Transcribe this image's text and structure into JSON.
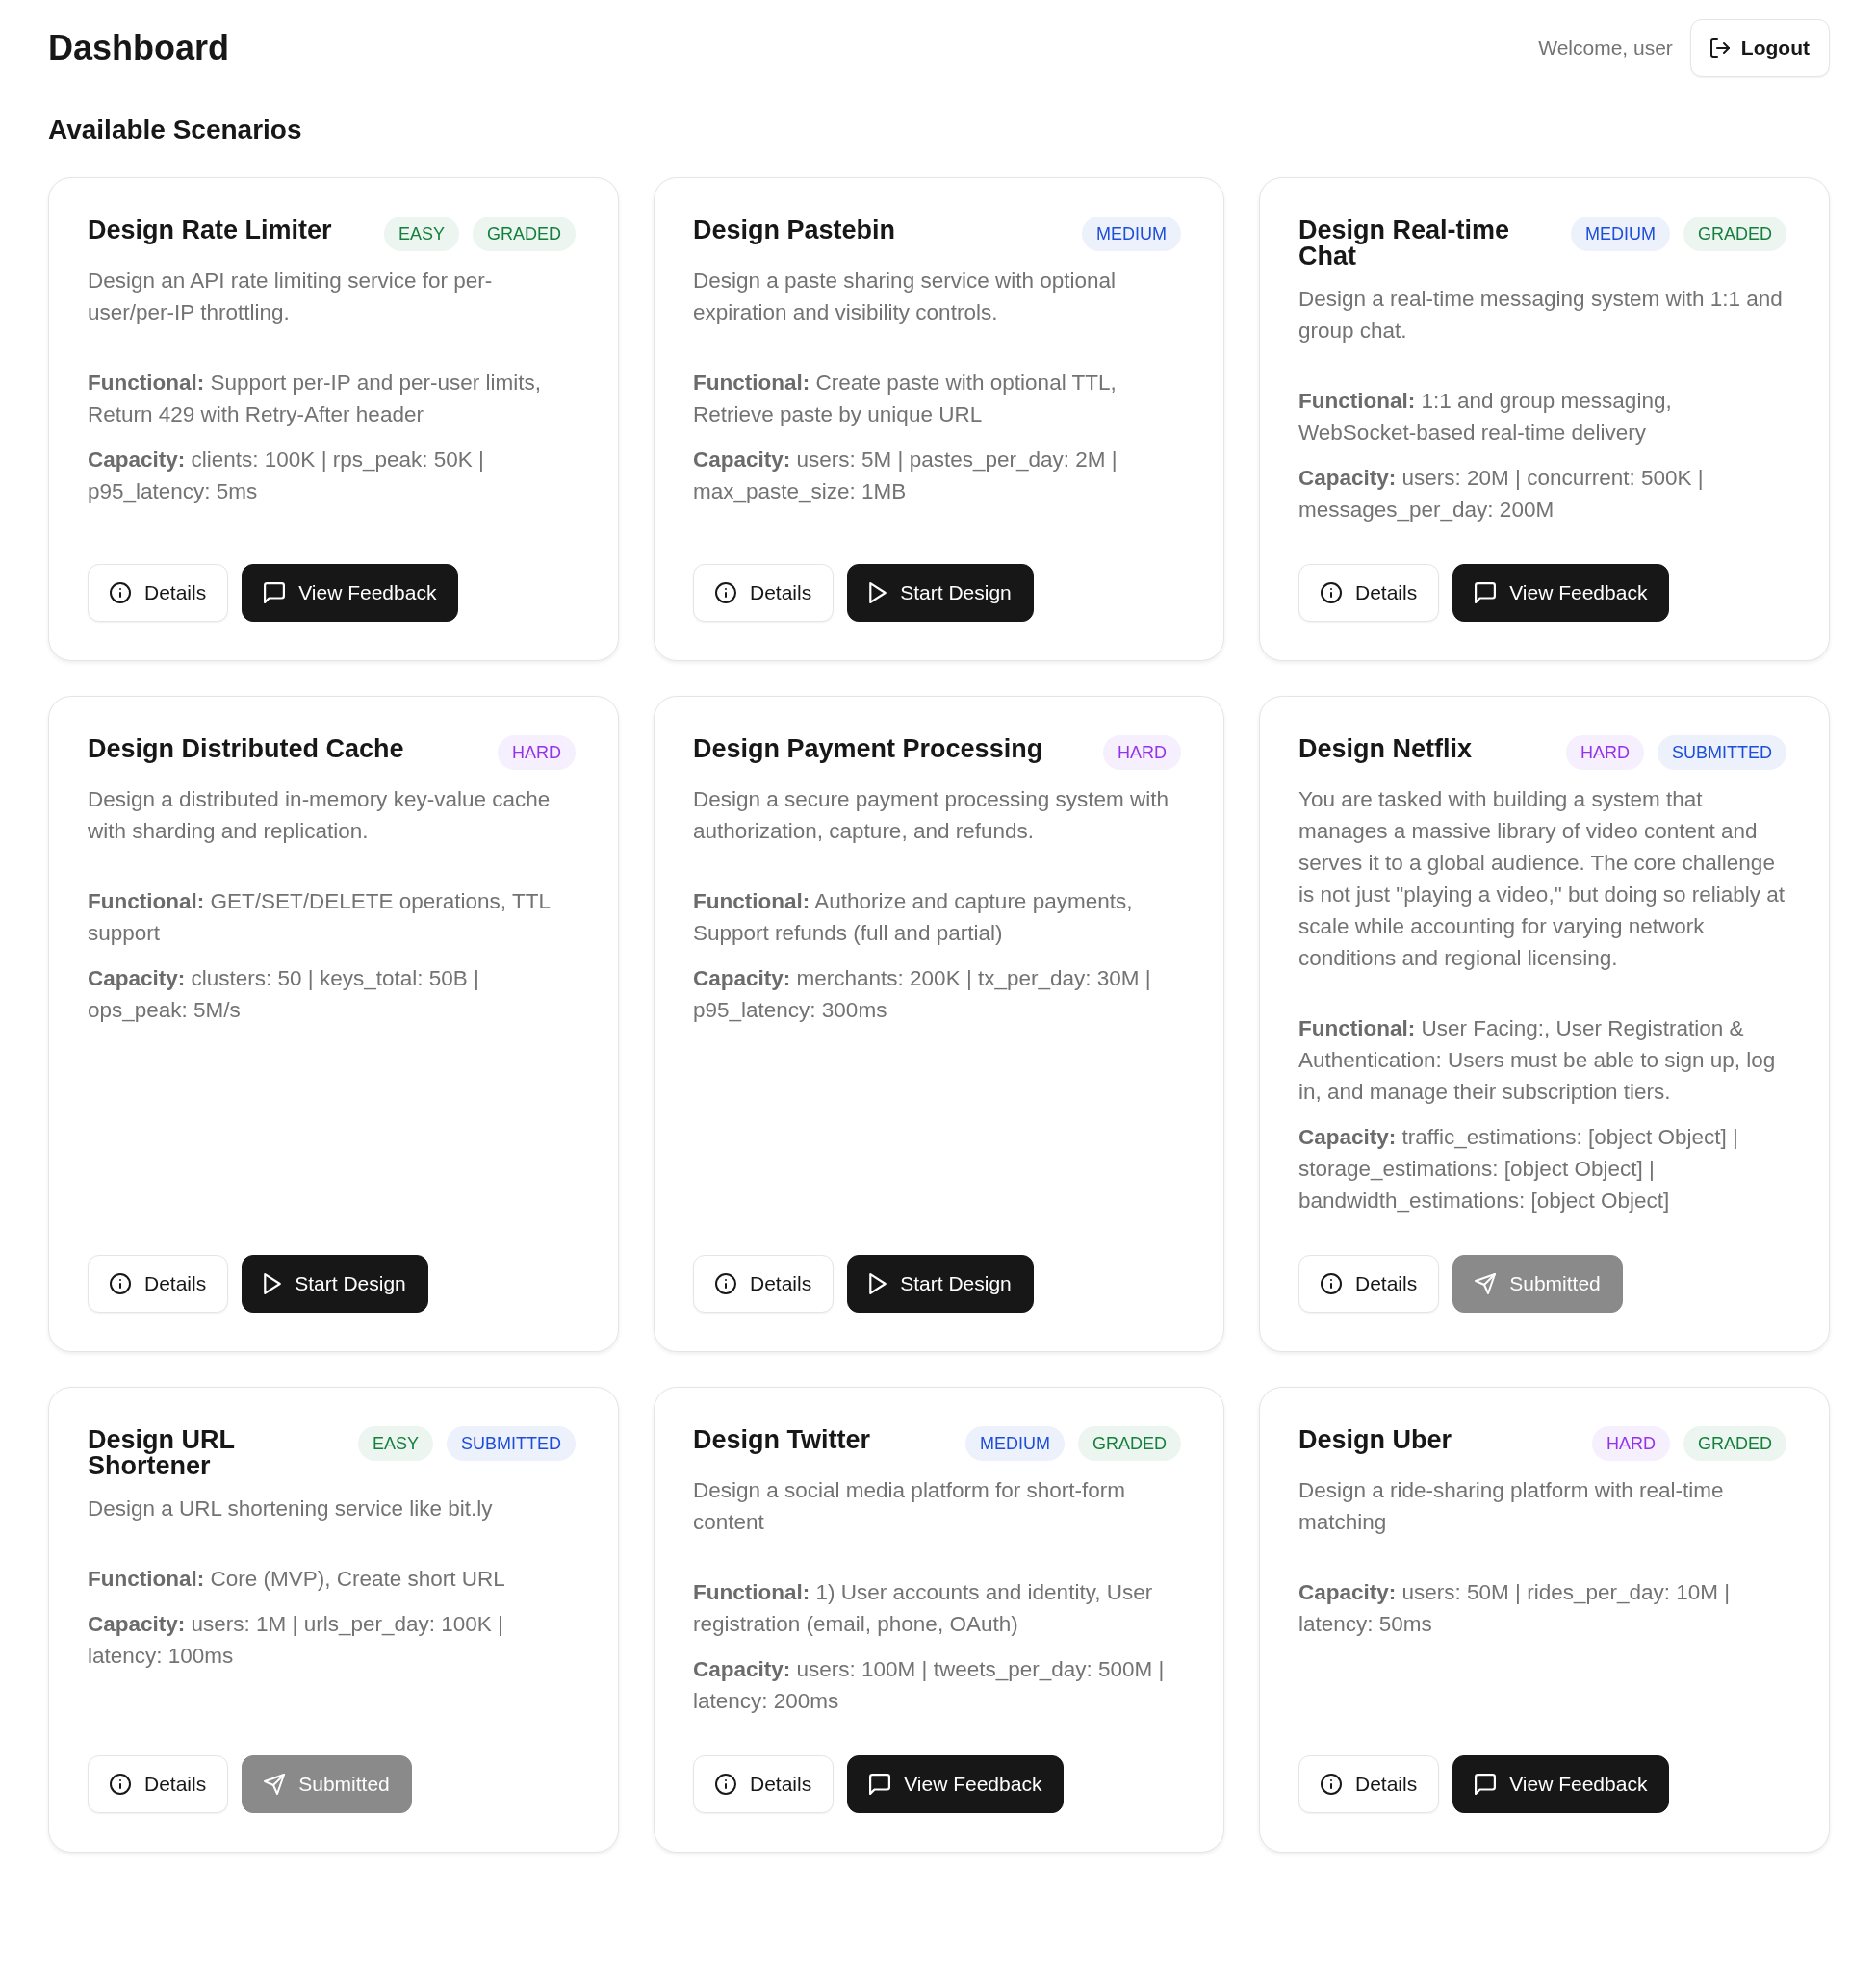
{
  "header": {
    "title": "Dashboard",
    "welcome": "Welcome, user",
    "logout": "Logout"
  },
  "section_title": "Available Scenarios",
  "cards": [
    {
      "title": "Design Rate Limiter",
      "badges": [
        {
          "text": "EASY",
          "color": "#15803d"
        },
        {
          "text": "GRADED",
          "color": "#15803d"
        }
      ],
      "description": "Design an API rate limiting service for per-user/per-IP throttling.",
      "requirements": [
        "**Functional:** Support per-IP and per-user limits, Return 429 with Retry-After header",
        "**Capacity:** clients: 100K | rps_peak: 50K | p95_latency: 5ms"
      ],
      "actions": [
        {
          "kind": "details",
          "label": "Details",
          "disabled": false
        },
        {
          "kind": "feedback",
          "label": "View Feedback",
          "disabled": false
        }
      ]
    },
    {
      "title": "Design Pastebin",
      "badges": [
        {
          "text": "MEDIUM",
          "color": "#1d4ed8"
        }
      ],
      "description": "Design a paste sharing service with optional expiration and visibility controls.",
      "requirements": [
        "**Functional:** Create paste with optional TTL, Retrieve paste by unique URL",
        "**Capacity:** users: 5M | pastes_per_day: 2M | max_paste_size: 1MB"
      ],
      "actions": [
        {
          "kind": "details",
          "label": "Details",
          "disabled": false
        },
        {
          "kind": "start",
          "label": "Start Design",
          "disabled": false
        }
      ]
    },
    {
      "title": "Design Real-time Chat",
      "badges": [
        {
          "text": "MEDIUM",
          "color": "#1d4ed8"
        },
        {
          "text": "GRADED",
          "color": "#15803d"
        }
      ],
      "description": "Design a real-time messaging system with 1:1 and group chat.",
      "requirements": [
        "**Functional:** 1:1 and group messaging, WebSocket-based real-time delivery",
        "**Capacity:** users: 20M | concurrent: 500K | messages_per_day: 200M"
      ],
      "actions": [
        {
          "kind": "details",
          "label": "Details",
          "disabled": false
        },
        {
          "kind": "feedback",
          "label": "View Feedback",
          "disabled": false
        }
      ]
    },
    {
      "title": "Design Distributed Cache",
      "badges": [
        {
          "text": "HARD",
          "color": "#9333ea"
        }
      ],
      "description": "Design a distributed in-memory key-value cache with sharding and replication.",
      "requirements": [
        "**Functional:** GET/SET/DELETE operations, TTL support",
        "**Capacity:** clusters: 50 | keys_total: 50B | ops_peak: 5M/s"
      ],
      "actions": [
        {
          "kind": "details",
          "label": "Details",
          "disabled": false
        },
        {
          "kind": "start",
          "label": "Start Design",
          "disabled": false
        }
      ]
    },
    {
      "title": "Design Payment Processing",
      "badges": [
        {
          "text": "HARD",
          "color": "#9333ea"
        }
      ],
      "description": "Design a secure payment processing system with authorization, capture, and refunds.",
      "requirements": [
        "**Functional:** Authorize and capture payments, Support refunds (full and partial)",
        "**Capacity:** merchants: 200K | tx_per_day: 30M | p95_latency: 300ms"
      ],
      "actions": [
        {
          "kind": "details",
          "label": "Details",
          "disabled": false
        },
        {
          "kind": "start",
          "label": "Start Design",
          "disabled": false
        }
      ]
    },
    {
      "title": "Design Netflix",
      "badges": [
        {
          "text": "HARD",
          "color": "#9333ea"
        },
        {
          "text": "SUBMITTED",
          "color": "#1d4ed8"
        }
      ],
      "description": "You are tasked with building a system that manages a massive library of video content and serves it to a global audience. The core challenge is not just \"playing a video,\" but doing so reliably at scale while accounting for varying network conditions and regional licensing.",
      "requirements": [
        "**Functional:** User Facing:, User Registration & Authentication: Users must be able to sign up, log in, and manage their subscription tiers.",
        "**Capacity:** traffic_estimations: [object Object] | storage_estimations: [object Object] | bandwidth_estimations: [object Object]"
      ],
      "actions": [
        {
          "kind": "details",
          "label": "Details",
          "disabled": false
        },
        {
          "kind": "submitted",
          "label": "Submitted",
          "disabled": true
        }
      ]
    },
    {
      "title": "Design URL Shortener",
      "badges": [
        {
          "text": "EASY",
          "color": "#15803d"
        },
        {
          "text": "SUBMITTED",
          "color": "#1d4ed8"
        }
      ],
      "description": "Design a URL shortening service like bit.ly",
      "requirements": [
        "**Functional:** Core (MVP), Create short URL",
        "**Capacity:** users: 1M | urls_per_day: 100K | latency: 100ms"
      ],
      "actions": [
        {
          "kind": "details",
          "label": "Details",
          "disabled": false
        },
        {
          "kind": "submitted",
          "label": "Submitted",
          "disabled": true
        }
      ]
    },
    {
      "title": "Design Twitter",
      "badges": [
        {
          "text": "MEDIUM",
          "color": "#1d4ed8"
        },
        {
          "text": "GRADED",
          "color": "#15803d"
        }
      ],
      "description": "Design a social media platform for short-form content",
      "requirements": [
        "**Functional:** 1) User accounts and identity, User registration (email, phone, OAuth)",
        "**Capacity:** users: 100M | tweets_per_day: 500M | latency: 200ms"
      ],
      "actions": [
        {
          "kind": "details",
          "label": "Details",
          "disabled": false
        },
        {
          "kind": "feedback",
          "label": "View Feedback",
          "disabled": false
        }
      ]
    },
    {
      "title": "Design Uber",
      "badges": [
        {
          "text": "HARD",
          "color": "#9333ea"
        },
        {
          "text": "GRADED",
          "color": "#15803d"
        }
      ],
      "description": "Design a ride-sharing platform with real-time matching",
      "requirements": [
        "**Capacity:** users: 50M | rides_per_day: 10M | latency: 50ms"
      ],
      "actions": [
        {
          "kind": "details",
          "label": "Details",
          "disabled": false
        },
        {
          "kind": "feedback",
          "label": "View Feedback",
          "disabled": false
        }
      ]
    }
  ]
}
